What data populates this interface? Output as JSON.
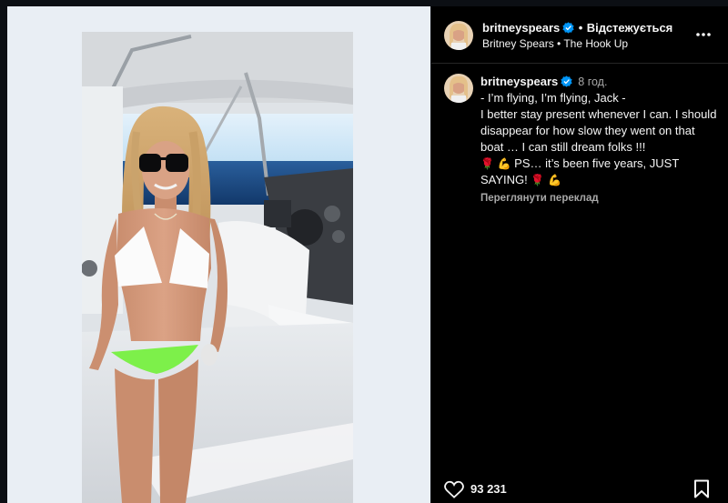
{
  "post": {
    "username": "britneyspears",
    "follow_status": "Відстежується",
    "separator": "•",
    "audio": "Britney Spears • The Hook Up",
    "time": "8 год.",
    "caption_lines": [
      "- I’m flying, I’m flying, Jack -",
      "I better stay present whenever I can. I should disappear for how slow they went on that boat … I can still dream folks !!!"
    ],
    "caption_tail_1": "PS… it’s been five years, JUST",
    "caption_tail_2": "SAYING!",
    "translate_label": "Переглянути переклад",
    "likes": "93 231"
  },
  "colors": {
    "background": "#000000",
    "verified": "#0095f6",
    "secondary_text": "#a8a8a8",
    "bikini_bottom": "#7df04a"
  },
  "icons": [
    "verified-badge-icon",
    "more-options-icon",
    "heart-icon",
    "bookmark-icon",
    "rose-emoji",
    "flexed-arm-emoji"
  ]
}
